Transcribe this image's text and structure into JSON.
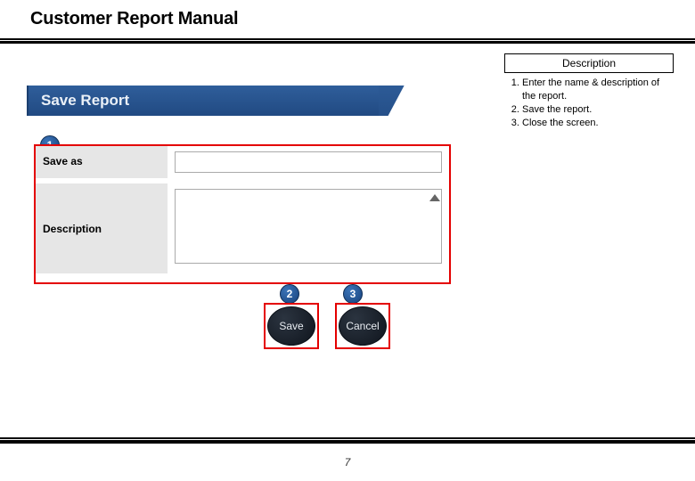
{
  "page": {
    "title": "Customer Report Manual",
    "number": "7"
  },
  "description": {
    "heading": "Description",
    "items": [
      "Enter the name & description of the report.",
      "Save the report.",
      "Close the screen."
    ]
  },
  "dialog": {
    "header": "Save Report",
    "save_as_label": "Save as",
    "save_as_value": "",
    "description_label": "Description",
    "description_value": "",
    "save_button": "Save",
    "cancel_button": "Cancel"
  },
  "markers": {
    "one": "1",
    "two": "2",
    "three": "3"
  }
}
